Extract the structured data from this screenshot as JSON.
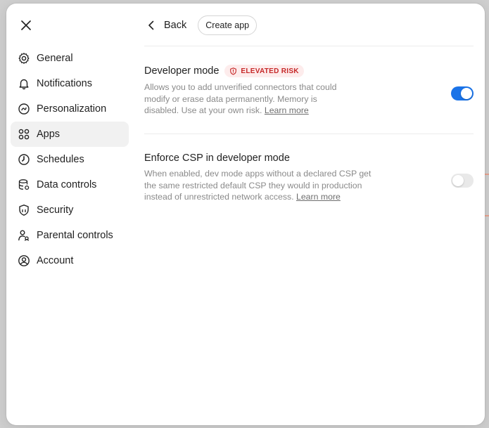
{
  "sidebar": {
    "items": [
      {
        "label": "General",
        "icon": "gear-icon",
        "active": false
      },
      {
        "label": "Notifications",
        "icon": "bell-icon",
        "active": false
      },
      {
        "label": "Personalization",
        "icon": "personalization-icon",
        "active": false
      },
      {
        "label": "Apps",
        "icon": "apps-grid-icon",
        "active": true
      },
      {
        "label": "Schedules",
        "icon": "clock-icon",
        "active": false
      },
      {
        "label": "Data controls",
        "icon": "database-icon",
        "active": false
      },
      {
        "label": "Security",
        "icon": "shield-icon",
        "active": false
      },
      {
        "label": "Parental controls",
        "icon": "parental-icon",
        "active": false
      },
      {
        "label": "Account",
        "icon": "account-icon",
        "active": false
      }
    ]
  },
  "header": {
    "back_label": "Back",
    "create_label": "Create app"
  },
  "settings": {
    "developer_mode": {
      "title": "Developer mode",
      "badge": "ELEVATED RISK",
      "description": "Allows you to add unverified connectors that could modify or erase data permanently. Memory is disabled. Use at your own risk.",
      "link": "Learn more",
      "enabled": true
    },
    "enforce_csp": {
      "title": "Enforce CSP in developer mode",
      "description": "When enabled, dev mode apps without a declared CSP get the same restricted default CSP they would in production instead of unrestricted network access.",
      "link": "Learn more",
      "enabled": false
    }
  },
  "colors": {
    "accent": "#1a73e8",
    "badge_bg": "#fdecec",
    "badge_text": "#c62828"
  }
}
